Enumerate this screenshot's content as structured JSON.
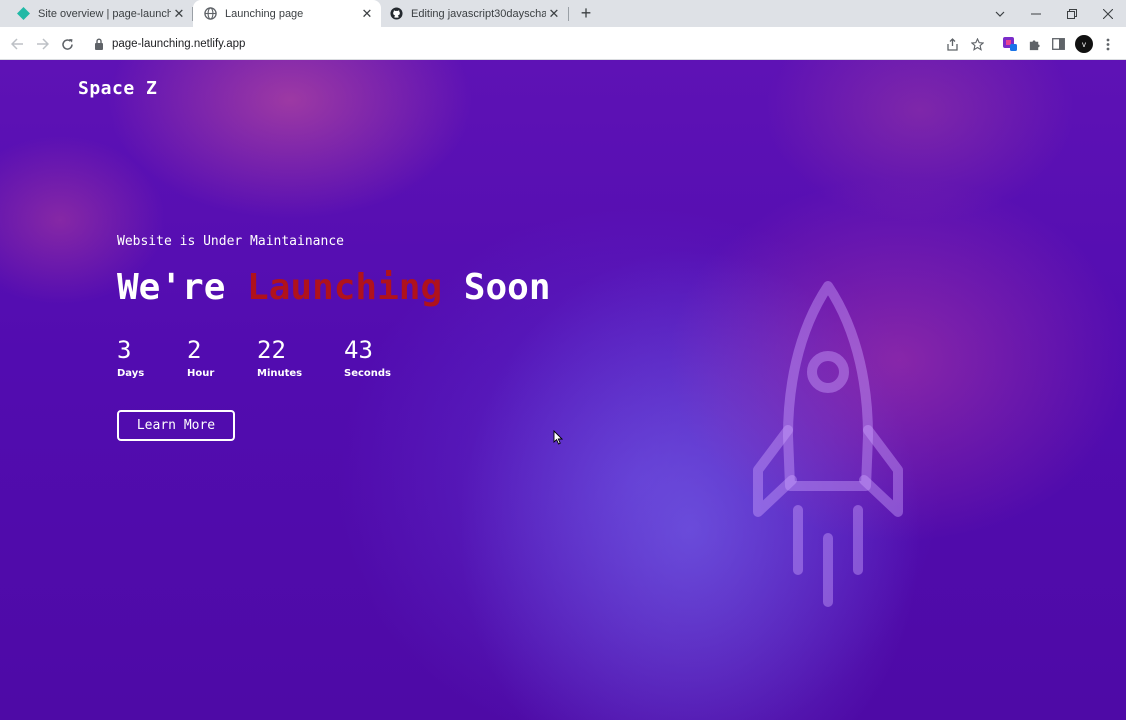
{
  "browser": {
    "tabs": [
      {
        "title": "Site overview | page-launching |",
        "favicon": "netlify-diamond-icon"
      },
      {
        "title": "Launching page",
        "favicon": "globe-icon"
      },
      {
        "title": "Editing javascript30dayschalleng",
        "favicon": "github-icon"
      }
    ],
    "new_tab_label": "+",
    "url": "page-launching.netlify.app",
    "profile_initial": "v"
  },
  "page": {
    "brand": "Space Z",
    "subtitle": "Website is Under Maintainance",
    "headline": {
      "before": "We're ",
      "accent": "Launching",
      "after": " Soon"
    },
    "accent_color": "#b0121c",
    "countdown": [
      {
        "value": "3",
        "label": "Days"
      },
      {
        "value": "2",
        "label": "Hour"
      },
      {
        "value": "22",
        "label": "Minutes"
      },
      {
        "value": "43",
        "label": "Seconds"
      }
    ],
    "cta_label": "Learn More"
  }
}
